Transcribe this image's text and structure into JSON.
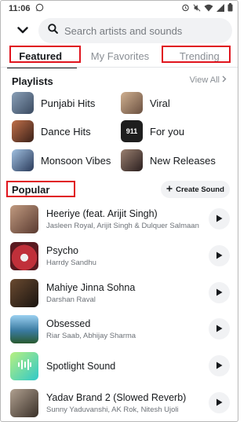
{
  "status_bar": {
    "time": "11:06"
  },
  "search": {
    "placeholder": "Search artists and sounds"
  },
  "tabs": [
    {
      "label": "Featured",
      "active": true
    },
    {
      "label": "My Favorites",
      "active": false
    },
    {
      "label": "Trending",
      "active": false
    }
  ],
  "playlists": {
    "title": "Playlists",
    "view_all": "View All",
    "items": [
      {
        "label": "Punjabi Hits",
        "color": "#5a6a80"
      },
      {
        "label": "Viral",
        "color": "#a88a6a"
      },
      {
        "label": "Dance Hits",
        "color": "#7a4a3a"
      },
      {
        "label": "For you",
        "color": "#2a2a2a"
      },
      {
        "label": "Monsoon Vibes",
        "color": "#3a5a7a"
      },
      {
        "label": "New Releases",
        "color": "#5a4a4a"
      }
    ]
  },
  "popular": {
    "title": "Popular",
    "create_label": "Create Sound",
    "songs": [
      {
        "title": "Heeriye (feat. Arijit Singh)",
        "artist": "Jasleen Royal, Arijit Singh & Dulquer Salmaan",
        "color": "#8a6a5a"
      },
      {
        "title": "Psycho",
        "artist": "Harrdy Sandhu",
        "color": "#b5323a"
      },
      {
        "title": "Mahiye Jinna Sohna",
        "artist": "Darshan Raval",
        "color": "#3a2a24"
      },
      {
        "title": "Obsessed",
        "artist": "Riar Saab, Abhijay Sharma",
        "color": "#4a8ac0"
      },
      {
        "title": "Spotlight Sound",
        "artist": "",
        "color": "#5ad0b0"
      },
      {
        "title": "Yadav Brand 2 (Slowed Reverb)",
        "artist": "Sunny Yaduvanshi, AK Rok, Nitesh Ujoli",
        "color": "#7a6a5a"
      }
    ]
  }
}
